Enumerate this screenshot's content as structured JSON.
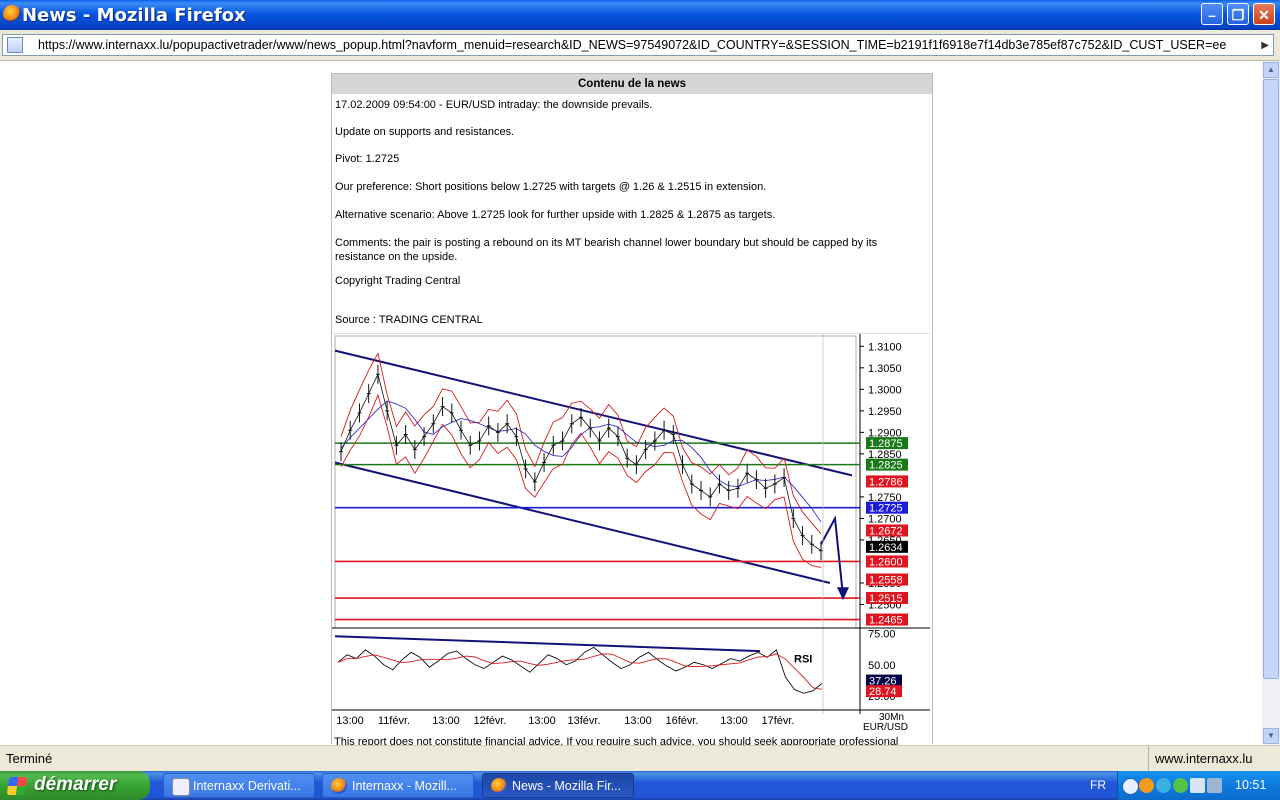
{
  "window": {
    "title": "News - Mozilla Firefox"
  },
  "address": {
    "url": "https://www.internaxx.lu/popupactivetrader/www/news_popup.html?navform_menuid=research&ID_NEWS=97549072&ID_COUNTRY=&SESSION_TIME=b2191f1f6918e7f14db3e785ef87c752&ID_CUST_USER=ee"
  },
  "news": {
    "header": "Contenu de la news",
    "line1": "17.02.2009 09:54:00 - EUR/USD intraday: the downside prevails.",
    "line2": "Update on supports and resistances.",
    "pivot": "Pivot: 1.2725",
    "preference": "Our preference: Short positions below 1.2725 with targets @ 1.26 & 1.2515 in extension.",
    "alternative": "Alternative scenario: Above 1.2725 look for further upside with 1.2825 & 1.2875 as targets.",
    "comments": "Comments: the pair is posting a rebound on its MT bearish channel lower boundary but should be capped by its resistance on the upside.",
    "copyright": "Copyright Trading Central",
    "source": "Source : TRADING CENTRAL",
    "disclaimer": "This report does not constitute financial advice. If you require such advice, you should seek appropriate professional"
  },
  "chart_data": {
    "type": "line",
    "title": "",
    "x_labels": [
      "13:00",
      "11févr.",
      "13:00",
      "12févr.",
      "13:00",
      "13févr.",
      "13:00",
      "16févr.",
      "13:00",
      "17févr."
    ],
    "x_axis_note": "30Mn",
    "instrument": "EUR/USD",
    "y_ticks": [
      "1.3100",
      "1.3050",
      "1.3000",
      "1.2950",
      "1.2900",
      "1.2850",
      "1.2750",
      "1.2700",
      "1.2650",
      "1.2550",
      "1.2500"
    ],
    "ylim": [
      1.245,
      1.311
    ],
    "price_series": [
      1.2855,
      1.2905,
      1.2945,
      1.299,
      1.3035,
      1.295,
      1.287,
      1.2895,
      1.286,
      1.289,
      1.292,
      1.296,
      1.2945,
      1.2905,
      1.287,
      1.288,
      1.2915,
      1.29,
      1.292,
      1.289,
      1.2815,
      1.2785,
      1.283,
      1.287,
      1.288,
      1.292,
      1.2935,
      1.291,
      1.288,
      1.291,
      1.289,
      1.284,
      1.2825,
      1.286,
      1.288,
      1.2905,
      1.2895,
      1.2825,
      1.278,
      1.2765,
      1.275,
      1.278,
      1.2765,
      1.277,
      1.2805,
      1.279,
      1.277,
      1.278,
      1.2795,
      1.27,
      1.266,
      1.264,
      1.2625
    ],
    "levels": [
      {
        "value": 1.2875,
        "label": "1.2875",
        "color": "#1a7a1a"
      },
      {
        "value": 1.2825,
        "label": "1.2825",
        "color": "#1a7a1a"
      },
      {
        "value": 1.2786,
        "label": "1.2786",
        "color": "#e0141e"
      },
      {
        "value": 1.2725,
        "label": "1.2725",
        "color": "#1b1bd8"
      },
      {
        "value": 1.2672,
        "label": "1.2672",
        "color": "#e0141e"
      },
      {
        "value": 1.2634,
        "label": "1.2634",
        "color": "#000000"
      },
      {
        "value": 1.26,
        "label": "1.2600",
        "color": "#e0141e"
      },
      {
        "value": 1.2558,
        "label": "1.2558",
        "color": "#e0141e"
      },
      {
        "value": 1.2515,
        "label": "1.2515",
        "color": "#e0141e"
      },
      {
        "value": 1.2465,
        "label": "1.2465",
        "color": "#e0141e"
      }
    ],
    "rsi": {
      "label": "RSI",
      "y_ticks": [
        "75.00",
        "50.00",
        "25.00"
      ],
      "ylim": [
        20,
        78
      ],
      "series": [
        52,
        58,
        55,
        62,
        57,
        50,
        46,
        54,
        60,
        56,
        48,
        53,
        59,
        61,
        55,
        50,
        47,
        52,
        57,
        54,
        49,
        44,
        51,
        58,
        55,
        50,
        53,
        60,
        64,
        58,
        52,
        47,
        50,
        56,
        60,
        54,
        49,
        45,
        48,
        52,
        50,
        47,
        51,
        55,
        53,
        57,
        60,
        56,
        62,
        40,
        30,
        27,
        29,
        35
      ],
      "values": [
        {
          "value": 37.26,
          "label": "37.26",
          "color": "#000044"
        },
        {
          "value": 28.74,
          "label": "28.74",
          "color": "#e0141e"
        }
      ]
    }
  },
  "status": {
    "left": "Terminé",
    "right": "www.internaxx.lu"
  },
  "taskbar": {
    "start_label": "démarrer",
    "tasks": [
      {
        "label": "Internaxx Derivati..."
      },
      {
        "label": "Internaxx - Mozill..."
      },
      {
        "label": "News - Mozilla Fir..."
      }
    ],
    "lang": "FR",
    "clock": "10:51"
  }
}
